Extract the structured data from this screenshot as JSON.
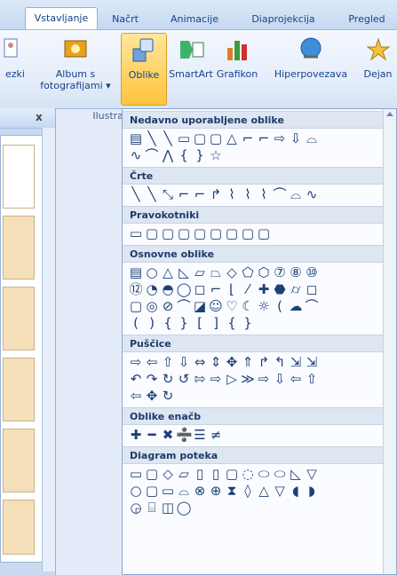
{
  "tabs": [
    "Vstavljanje",
    "Načrt",
    "Animacije",
    "Diaprojekcija",
    "Pregled"
  ],
  "ribbon": {
    "buttons": [
      {
        "label": "ezki",
        "icon": "clip-art-icon"
      },
      {
        "label": "Album s fotografijami ▾",
        "icon": "photo-album-icon"
      },
      {
        "label": "Oblike",
        "icon": "shapes-icon"
      },
      {
        "label": "SmartArt",
        "icon": "smartart-icon"
      },
      {
        "label": "Grafikon",
        "icon": "chart-icon"
      },
      {
        "label": "Hiperpovezava",
        "icon": "hyperlink-icon"
      },
      {
        "label": "Dejan",
        "icon": "action-icon"
      }
    ],
    "group_label": "Ilustrac"
  },
  "left_pane": {
    "close_glyph": "x"
  },
  "sections": [
    {
      "title": "Nedavno uporabljene oblike",
      "rows": [
        "▤╲╲▭▢▢△⌐⌐⇨⇩⌓",
        "∿⌒⋀{}☆"
      ]
    },
    {
      "title": "Črte",
      "rows": [
        "╲╲⤡⌐⌐↱⌇⌇⌇⌒⌓∿"
      ]
    },
    {
      "title": "Pravokotniki",
      "rows": [
        "▭▢▢▢▢▢▢▢▢"
      ]
    },
    {
      "title": "Osnovne oblike",
      "rows": [
        "▤○△◺▱⏢◇⬠⬡⑦⑧⑩",
        "⑫◔◓◯◻⌐⌊⁄✚⬣⌭◻",
        "▢◎⊘⌒◪☺♡☾☼(☁⌒",
        "(){}[]{}"
      ]
    },
    {
      "title": "Puščice",
      "rows": [
        "⇨⇦⇧⇩⇔⇕✥⇑↱↰⇲⇲",
        "↶↷↻↺⇰⇨▷≫⇨⇩⇦⇧",
        "⇦✥↻"
      ]
    },
    {
      "title": "Oblike enačb",
      "rows": [
        "✚━✖➗☰≠"
      ]
    },
    {
      "title": "Diagram poteka",
      "rows": [
        "▭▢◇▱▯▯▢◌⬭⬭◺▽",
        "○▢▭⌓⊗⊕⧗◊△▽◖◗",
        "◶⌸◫◯"
      ]
    }
  ]
}
